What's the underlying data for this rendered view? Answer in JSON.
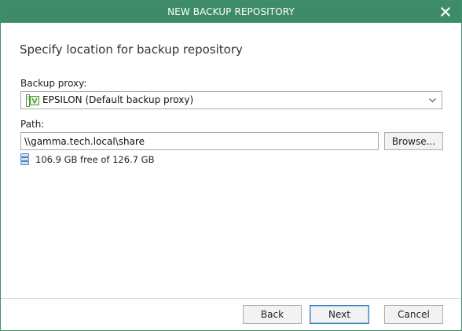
{
  "window": {
    "title": "NEW BACKUP REPOSITORY",
    "accent_color": "#3d8b68",
    "close_icon": "close-icon"
  },
  "page": {
    "heading": "Specify location for backup repository"
  },
  "backup_proxy": {
    "label": "Backup proxy:",
    "selected_value": "EPSILON (Default backup proxy)",
    "icon": "server-icon"
  },
  "path": {
    "label": "Path:",
    "value": "\\\\gamma.tech.local\\share",
    "browse_label": "Browse..."
  },
  "storage": {
    "free_text": "106.9 GB free of 126.7 GB",
    "icon": "database-icon"
  },
  "footer": {
    "back_label": "Back",
    "next_label": "Next",
    "cancel_label": "Cancel"
  }
}
